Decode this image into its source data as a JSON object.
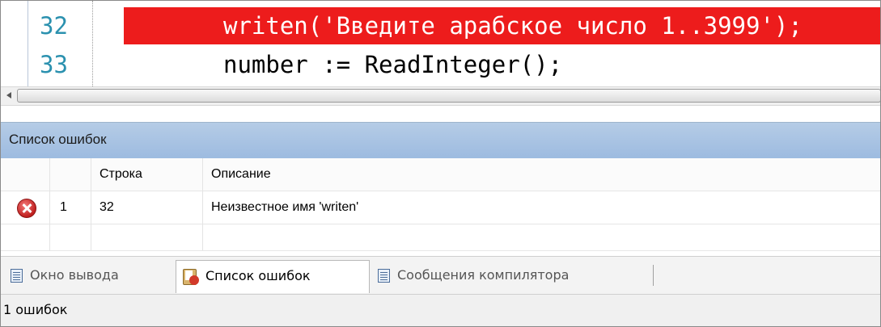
{
  "editor": {
    "lines": [
      {
        "number": "32",
        "code": "writen('Введите арабское число 1..3999');",
        "highlighted": true
      },
      {
        "number": "33",
        "code": "number := ReadInteger();",
        "highlighted": false
      }
    ],
    "highlight_color": "#ed1c1c"
  },
  "error_panel": {
    "title": "Список ошибок",
    "columns": [
      "",
      "",
      "Строка",
      "Описание"
    ],
    "rows": [
      {
        "icon": "error-icon",
        "index": "1",
        "line": "32",
        "description": "Неизвестное имя 'writen'"
      }
    ]
  },
  "tabs": [
    {
      "label": "Окно вывода",
      "icon": "output-window-icon",
      "active": false
    },
    {
      "label": "Список ошибок",
      "icon": "error-list-icon",
      "active": true
    },
    {
      "label": "Сообщения компилятора",
      "icon": "compiler-messages-icon",
      "active": false
    }
  ],
  "status": {
    "text": "1 ошибок"
  }
}
